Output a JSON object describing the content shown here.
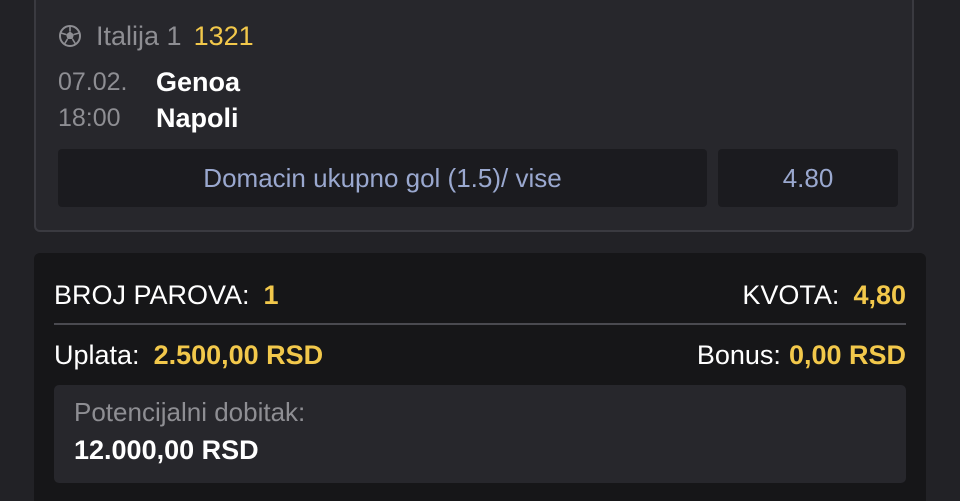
{
  "match": {
    "league_icon": "soccer-ball-icon",
    "league_name": "Italija 1",
    "league_code": "1321",
    "date": "07.02.",
    "time": "18:00",
    "home_team": "Genoa",
    "away_team": "Napoli",
    "bet_label": "Domacin ukupno gol (1.5)/ vise",
    "odd": "4.80"
  },
  "summary": {
    "pairs_label": "BROJ PAROVA:",
    "pairs_value": "1",
    "odds_label": "KVOTA:",
    "odds_value": "4,80",
    "stake_label": "Uplata:",
    "stake_value": "2.500,00 RSD",
    "bonus_label": "Bonus:",
    "bonus_value": "0,00 RSD",
    "potential_label": "Potencijalni dobitak:",
    "potential_value": "12.000,00 RSD"
  },
  "colors": {
    "background": "#222226",
    "accent": "#f2c84b",
    "bet_text": "#9aa8cf"
  }
}
